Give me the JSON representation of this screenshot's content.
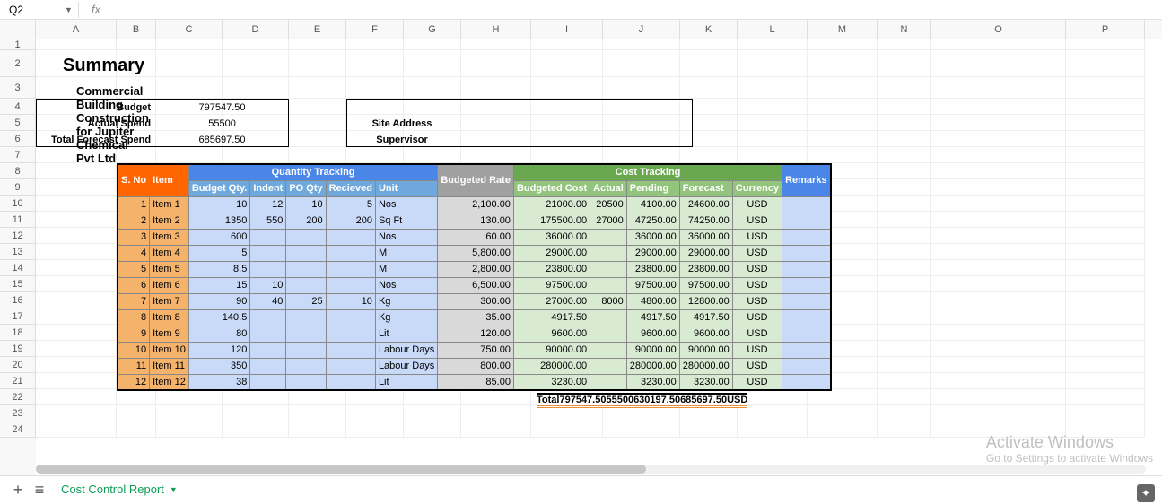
{
  "name_box": "Q2",
  "formula_value": "",
  "columns": [
    "A",
    "B",
    "C",
    "D",
    "E",
    "F",
    "G",
    "H",
    "I",
    "J",
    "K",
    "L",
    "M",
    "N",
    "O",
    "P"
  ],
  "row_numbers": [
    1,
    2,
    3,
    4,
    5,
    6,
    7,
    8,
    9,
    10,
    11,
    12,
    13,
    14,
    15,
    16,
    17,
    18,
    19,
    20,
    21,
    22,
    23,
    24
  ],
  "summary_title": "Summary",
  "project_title": "Commercial Building Construction for Jupiter Chemical Pvt Ltd",
  "budget_block": {
    "rows": [
      {
        "label": "Budget",
        "value": "797547.50"
      },
      {
        "label": "Actual Spend",
        "value": "55500"
      },
      {
        "label": "Total Forecast Spend",
        "value": "685697.50"
      }
    ]
  },
  "site_block": {
    "labels": [
      "Site Address",
      "Supervisor"
    ]
  },
  "headers": {
    "sno": "S. No",
    "item": "Item",
    "quantity_tracking": "Quantity Tracking",
    "budget_qty": "Budget Qty.",
    "indent": "Indent",
    "po_qty": "PO Qty",
    "received": "Recieved",
    "unit": "Unit",
    "budgeted_rate": "Budgeted Rate",
    "cost_tracking": "Cost Tracking",
    "budgeted_cost": "Budgeted Cost",
    "actual": "Actual",
    "pending": "Pending",
    "forecast": "Forecast",
    "currency": "Currency",
    "remarks": "Remarks"
  },
  "rows": [
    {
      "sno": "1",
      "item": "Item 1",
      "bqty": "10",
      "indent": "12",
      "po": "10",
      "recv": "5",
      "unit": "Nos",
      "rate": "2,100.00",
      "bcost": "21000.00",
      "actual": "20500",
      "pending": "4100.00",
      "forecast": "24600.00",
      "ccy": "USD"
    },
    {
      "sno": "2",
      "item": "Item 2",
      "bqty": "1350",
      "indent": "550",
      "po": "200",
      "recv": "200",
      "unit": "Sq Ft",
      "rate": "130.00",
      "bcost": "175500.00",
      "actual": "27000",
      "pending": "47250.00",
      "forecast": "74250.00",
      "ccy": "USD"
    },
    {
      "sno": "3",
      "item": "Item 3",
      "bqty": "600",
      "indent": "",
      "po": "",
      "recv": "",
      "unit": "Nos",
      "rate": "60.00",
      "bcost": "36000.00",
      "actual": "",
      "pending": "36000.00",
      "forecast": "36000.00",
      "ccy": "USD"
    },
    {
      "sno": "4",
      "item": "Item 4",
      "bqty": "5",
      "indent": "",
      "po": "",
      "recv": "",
      "unit": "M",
      "rate": "5,800.00",
      "bcost": "29000.00",
      "actual": "",
      "pending": "29000.00",
      "forecast": "29000.00",
      "ccy": "USD"
    },
    {
      "sno": "5",
      "item": "Item 5",
      "bqty": "8.5",
      "indent": "",
      "po": "",
      "recv": "",
      "unit": "M",
      "rate": "2,800.00",
      "bcost": "23800.00",
      "actual": "",
      "pending": "23800.00",
      "forecast": "23800.00",
      "ccy": "USD"
    },
    {
      "sno": "6",
      "item": "Item 6",
      "bqty": "15",
      "indent": "10",
      "po": "",
      "recv": "",
      "unit": "Nos",
      "rate": "6,500.00",
      "bcost": "97500.00",
      "actual": "",
      "pending": "97500.00",
      "forecast": "97500.00",
      "ccy": "USD"
    },
    {
      "sno": "7",
      "item": "Item 7",
      "bqty": "90",
      "indent": "40",
      "po": "25",
      "recv": "10",
      "unit": "Kg",
      "rate": "300.00",
      "bcost": "27000.00",
      "actual": "8000",
      "pending": "4800.00",
      "forecast": "12800.00",
      "ccy": "USD"
    },
    {
      "sno": "8",
      "item": "Item 8",
      "bqty": "140.5",
      "indent": "",
      "po": "",
      "recv": "",
      "unit": "Kg",
      "rate": "35.00",
      "bcost": "4917.50",
      "actual": "",
      "pending": "4917.50",
      "forecast": "4917.50",
      "ccy": "USD"
    },
    {
      "sno": "9",
      "item": "Item 9",
      "bqty": "80",
      "indent": "",
      "po": "",
      "recv": "",
      "unit": "Lit",
      "rate": "120.00",
      "bcost": "9600.00",
      "actual": "",
      "pending": "9600.00",
      "forecast": "9600.00",
      "ccy": "USD"
    },
    {
      "sno": "10",
      "item": "Item 10",
      "bqty": "120",
      "indent": "",
      "po": "",
      "recv": "",
      "unit": "Labour Days",
      "rate": "750.00",
      "bcost": "90000.00",
      "actual": "",
      "pending": "90000.00",
      "forecast": "90000.00",
      "ccy": "USD"
    },
    {
      "sno": "11",
      "item": "Item 11",
      "bqty": "350",
      "indent": "",
      "po": "",
      "recv": "",
      "unit": "Labour Days",
      "rate": "800.00",
      "bcost": "280000.00",
      "actual": "",
      "pending": "280000.00",
      "forecast": "280000.00",
      "ccy": "USD"
    },
    {
      "sno": "12",
      "item": "Item 12",
      "bqty": "38",
      "indent": "",
      "po": "",
      "recv": "",
      "unit": "Lit",
      "rate": "85.00",
      "bcost": "3230.00",
      "actual": "",
      "pending": "3230.00",
      "forecast": "3230.00",
      "ccy": "USD"
    }
  ],
  "totals": {
    "label": "Total",
    "bcost": "797547.50",
    "actual": "55500",
    "pending": "630197.50",
    "forecast": "685697.50",
    "ccy": "USD"
  },
  "sheet_tab": "Cost Control Report",
  "watermark": {
    "line1": "Activate Windows",
    "line2": "Go to Settings to activate Windows"
  },
  "col_widths": {
    "A": 90,
    "B": 44,
    "C": 74,
    "D": 74,
    "E": 64,
    "F": 64,
    "G": 64,
    "H": 78,
    "I": 80,
    "J": 86,
    "K": 64,
    "L": 78,
    "M": 78,
    "N": 60,
    "O": 150,
    "P": 88
  }
}
